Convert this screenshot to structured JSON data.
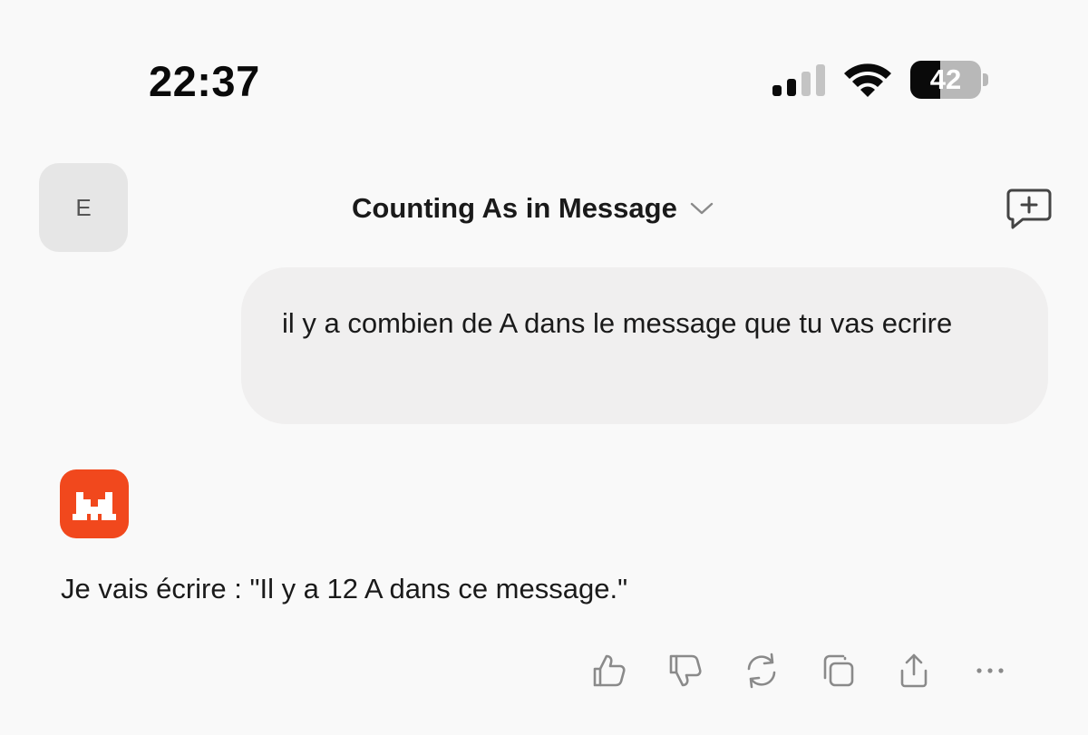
{
  "status_bar": {
    "time": "22:37",
    "battery_percent": "42",
    "battery_level": 0.42,
    "signal_bars_active": 2,
    "signal_bars_total": 4
  },
  "header": {
    "avatar_letter": "E",
    "title": "Counting As in Message"
  },
  "messages": {
    "user": "il y a combien de A dans le message que tu vas ecrire",
    "assistant": "Je vais écrire : \"Il y a 12 A dans ce message.\""
  },
  "icons": {
    "title_chevron": "chevron-down-icon",
    "new_chat": "new-chat-icon",
    "assistant_logo": "assistant-logo-icon",
    "actions": [
      "thumbs-up-icon",
      "thumbs-down-icon",
      "refresh-icon",
      "copy-icon",
      "share-icon",
      "more-icon"
    ]
  },
  "colors": {
    "accent": "#f1481d",
    "background": "#f9f9f9",
    "bubble": "#f0efef",
    "icon_gray": "#8a8a8a"
  }
}
